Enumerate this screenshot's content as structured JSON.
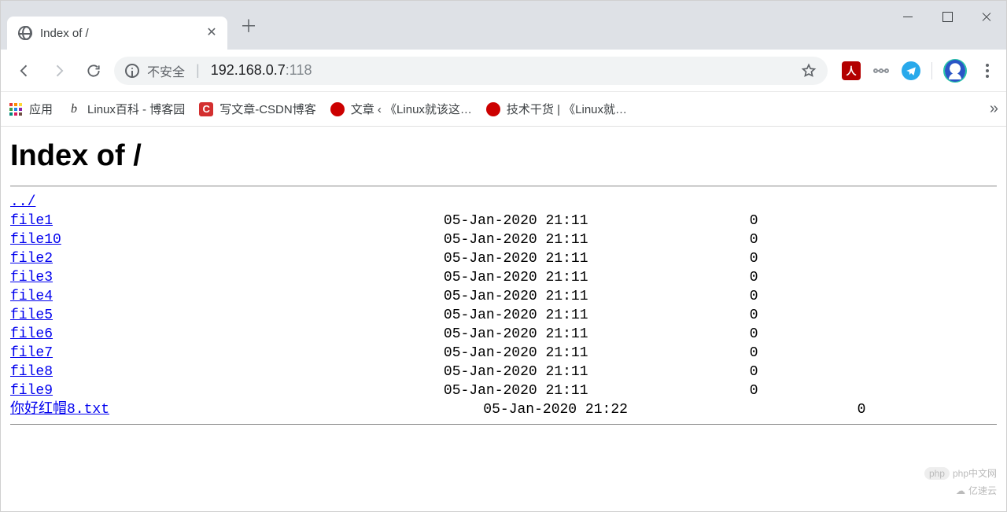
{
  "tab": {
    "title": "Index of /"
  },
  "omnibox": {
    "security_label": "不安全",
    "host": "192.168.0.7",
    "port": ":118"
  },
  "bookmarks": {
    "apps": "应用",
    "items": [
      {
        "label": "Linux百科 - 博客园"
      },
      {
        "label": "写文章-CSDN博客"
      },
      {
        "label": "文章 ‹ 《Linux就该这…"
      },
      {
        "label": "技术干货 | 《Linux就…"
      }
    ],
    "more": "»"
  },
  "page": {
    "heading": "Index of /",
    "parent": "../",
    "files": [
      {
        "name": "file1",
        "date": "05-Jan-2020 21:11",
        "size": "0"
      },
      {
        "name": "file10",
        "date": "05-Jan-2020 21:11",
        "size": "0"
      },
      {
        "name": "file2",
        "date": "05-Jan-2020 21:11",
        "size": "0"
      },
      {
        "name": "file3",
        "date": "05-Jan-2020 21:11",
        "size": "0"
      },
      {
        "name": "file4",
        "date": "05-Jan-2020 21:11",
        "size": "0"
      },
      {
        "name": "file5",
        "date": "05-Jan-2020 21:11",
        "size": "0"
      },
      {
        "name": "file6",
        "date": "05-Jan-2020 21:11",
        "size": "0"
      },
      {
        "name": "file7",
        "date": "05-Jan-2020 21:11",
        "size": "0"
      },
      {
        "name": "file8",
        "date": "05-Jan-2020 21:11",
        "size": "0"
      },
      {
        "name": "file9",
        "date": "05-Jan-2020 21:11",
        "size": "0"
      },
      {
        "name": "你好红帽8.txt",
        "date": "05-Jan-2020 21:22",
        "size": "0",
        "wide": true
      }
    ]
  },
  "watermarks": {
    "top": "php中文网",
    "bottom": "亿速云",
    "pill": "php"
  }
}
